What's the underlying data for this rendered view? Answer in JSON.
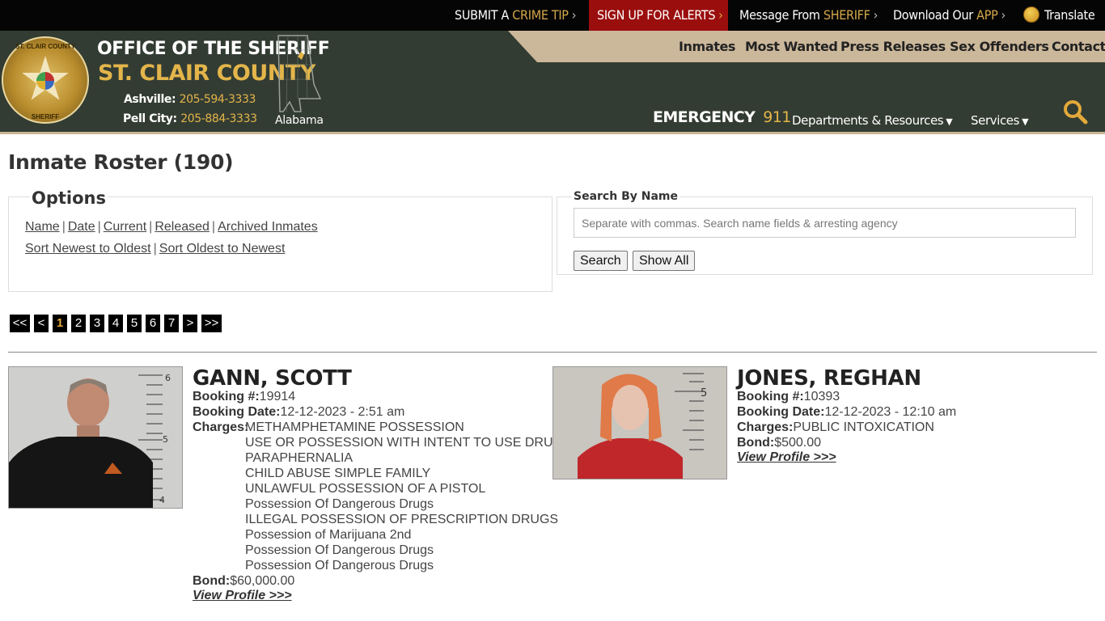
{
  "topbar": {
    "crime_tip": {
      "pre": "SUBMIT A ",
      "hl": "CRIME TIP"
    },
    "alerts": "SIGN UP FOR ALERTS",
    "message": {
      "pre": "Message From ",
      "hl": "SHERIFF"
    },
    "download": {
      "pre": "Download Our ",
      "hl": "APP"
    },
    "translate": "Translate",
    "chevron": "›"
  },
  "header": {
    "badge_top": "ST. CLAIR COUNTY",
    "badge_bottom": "SHERIFF",
    "title": "OFFICE OF THE SHERIFF",
    "county": "ST. CLAIR COUNTY",
    "phones": [
      {
        "city": "Ashville:",
        "number": "205-594-3333"
      },
      {
        "city": "Pell City:",
        "number": "205-884-3333"
      }
    ],
    "state_label": "Alabama",
    "emergency_label": "EMERGENCY",
    "emergency_number": "911",
    "nav": [
      "Inmates",
      "Most Wanted",
      "Press Releases",
      "Sex Offenders",
      "Contact"
    ],
    "dropdowns": [
      "Departments & Resources",
      "Services"
    ],
    "caret": "⌄"
  },
  "colors": {
    "accent": "#e3b54a",
    "alert": "#9b0e0e",
    "header_bg": "#333c33",
    "nav_strip": "#cbb79a"
  },
  "page": {
    "title": "Inmate Roster (190)"
  },
  "options": {
    "legend": "Options",
    "links_row1": [
      "Name",
      "Date",
      "Current",
      "Released",
      "Archived Inmates"
    ],
    "links_row2": [
      "Sort Newest to Oldest",
      "Sort Oldest to Newest"
    ]
  },
  "search": {
    "legend": "Search By Name",
    "placeholder": "Separate with commas. Search name fields & arresting agency",
    "value": "",
    "search_button": "Search",
    "show_all_button": "Show All"
  },
  "pager": {
    "first": "<<",
    "prev": "<",
    "pages": [
      "1",
      "2",
      "3",
      "4",
      "5",
      "6",
      "7"
    ],
    "current": "1",
    "next": ">",
    "last": ">>"
  },
  "inmates": [
    {
      "name": "GANN, SCOTT",
      "booking_label": "Booking #:",
      "booking_number": "19914",
      "date_label": "Booking Date:",
      "booking_date": "12-12-2023 - 2:51 am",
      "charges_label": "Charges:",
      "charges": [
        "METHAMPHETAMINE POSSESSION",
        "USE OR POSSESSION WITH INTENT TO USE DRUG",
        "PARAPHERNALIA",
        "CHILD ABUSE SIMPLE FAMILY",
        "UNLAWFUL POSSESSION OF A PISTOL",
        "Possession Of Dangerous Drugs",
        "ILLEGAL POSSESSION OF PRESCRIPTION DRUGS",
        "Possession of Marijuana 2nd",
        "Possession Of Dangerous Drugs",
        "Possession Of Dangerous Drugs"
      ],
      "bond_label": "Bond:",
      "bond": "$60,000.00",
      "view_link": "View Profile >>>",
      "ruler_marks": [
        "6",
        "5",
        "4"
      ]
    },
    {
      "name": "JONES, REGHAN",
      "booking_label": "Booking #:",
      "booking_number": "10393",
      "date_label": "Booking Date:",
      "booking_date": "12-12-2023 - 12:10 am",
      "charges_label": "Charges:",
      "charges": [
        "PUBLIC INTOXICATION"
      ],
      "bond_label": "Bond:",
      "bond": "$500.00",
      "view_link": "View Profile >>>",
      "ruler_marks": [
        "5"
      ]
    }
  ]
}
